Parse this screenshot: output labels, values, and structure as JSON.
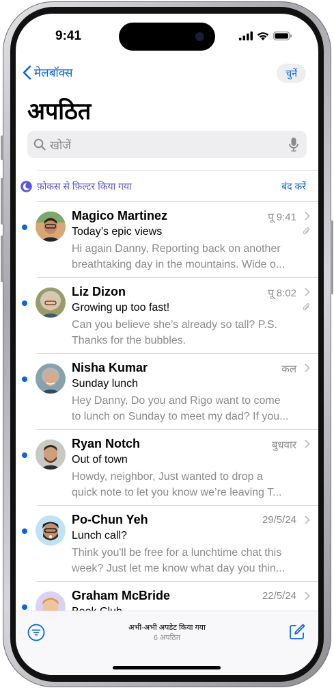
{
  "status": {
    "time": "9:41"
  },
  "nav": {
    "back_label": "मेलबॉक्स",
    "select_label": "चुनें"
  },
  "page_title": "अपठित",
  "search": {
    "placeholder": "खोजें"
  },
  "focus_filter": {
    "label": "फ़ोकस से फ़िल्टर किया गया",
    "off_label": "बंद करें"
  },
  "messages": [
    {
      "sender": "Magico Martinez",
      "date": "पू 9:41",
      "subject": "Today’s epic views",
      "preview_1": "Hi again Danny, Reporting back on another",
      "preview_2": "breathtaking day in the mountains. Wide o...",
      "has_attachment": true,
      "unread": true
    },
    {
      "sender": "Liz Dizon",
      "date": "पू 8:02",
      "subject": "Growing up too fast!",
      "preview_1": "Can you believe she’s already so tall? P.S.",
      "preview_2": "Thanks for the bubbles.",
      "has_attachment": true,
      "unread": true
    },
    {
      "sender": "Nisha Kumar",
      "date": "कल",
      "subject": "Sunday lunch",
      "preview_1": "Hey Danny, Do you and Rigo want to come",
      "preview_2": "to lunch on Sunday to meet my dad? If you...",
      "has_attachment": false,
      "unread": true
    },
    {
      "sender": "Ryan Notch",
      "date": "बुधवार",
      "subject": "Out of town",
      "preview_1": "Howdy, neighbor, Just wanted to drop a",
      "preview_2": "quick note to let you know we’re leaving T...",
      "has_attachment": false,
      "unread": true
    },
    {
      "sender": "Po-Chun Yeh",
      "date": "29/5/24",
      "subject": "Lunch call?",
      "preview_1": "Think you'll be free for a lunchtime chat this",
      "preview_2": "week? Just let me know what day you thin...",
      "has_attachment": false,
      "unread": true
    },
    {
      "sender": "Graham McBride",
      "date": "22/5/24",
      "subject": "Book Club",
      "preview_1": "",
      "preview_2": "",
      "has_attachment": false,
      "unread": true
    }
  ],
  "bottom_bar": {
    "update_text": "अभी-अभी अपडेट किया गया",
    "unread_count": "6 अपठित"
  },
  "colors": {
    "accent": "#0a64e0",
    "focus": "#5a58d6",
    "secondary_text": "#8a8a8e"
  },
  "icons": [
    "back-chevron-icon",
    "search-icon",
    "microphone-icon",
    "moon-icon",
    "chevron-right-icon",
    "paperclip-icon",
    "filter-icon",
    "compose-icon",
    "signal-icon",
    "wifi-icon",
    "battery-icon"
  ]
}
